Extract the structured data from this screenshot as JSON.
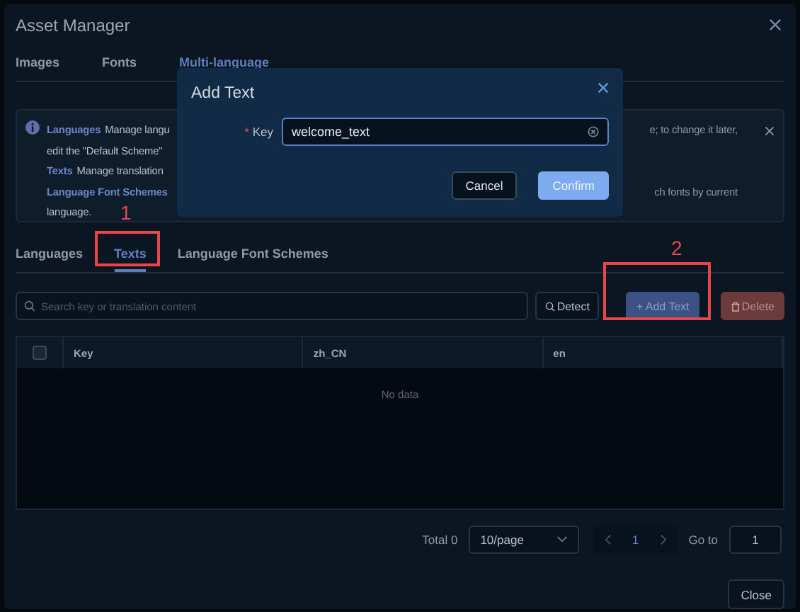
{
  "window": {
    "title": "Asset Manager"
  },
  "tabs": [
    {
      "label": "Images",
      "selected": false
    },
    {
      "label": "Fonts",
      "selected": false
    },
    {
      "label": "Multi-language",
      "selected": true
    }
  ],
  "info": {
    "lines": [
      {
        "term": "Languages",
        "left": "Manage langu",
        "right": "e; to change it later,"
      },
      {
        "left": "edit the \"Default Scheme\""
      },
      {
        "term": "Texts",
        "left": "Manage translation"
      },
      {
        "term": "Language Font Schemes",
        "right": "ch fonts by current"
      },
      {
        "left": "language."
      }
    ]
  },
  "subtabs": [
    {
      "label": "Languages",
      "selected": false
    },
    {
      "label": "Texts",
      "selected": true
    },
    {
      "label": "Language Font Schemes",
      "selected": false
    }
  ],
  "search": {
    "placeholder": "Search key or translation content"
  },
  "buttons": {
    "detect": "Detect",
    "add": "+ Add Text",
    "delete": "Delete"
  },
  "table": {
    "select_all_checked": false,
    "columns": [
      "Key",
      "zh_CN",
      "en"
    ],
    "empty": "No data"
  },
  "pagination": {
    "total": "Total 0",
    "page_size": "10/page",
    "page": "1",
    "goto_label": "Go to",
    "goto_value": "1"
  },
  "close": "Close",
  "dialog": {
    "title": "Add Text",
    "field_label": "Key",
    "required_mark": "*",
    "value": "welcome_text",
    "buttons": [
      "Cancel",
      "Confirm"
    ]
  },
  "annotations": [
    "1",
    "2"
  ]
}
